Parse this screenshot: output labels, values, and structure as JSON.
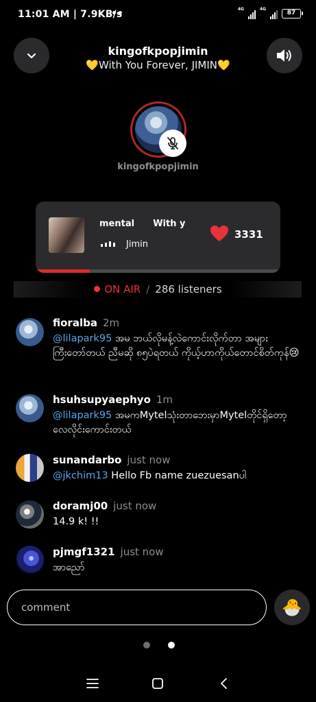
{
  "status_bar": {
    "time": "11:01 AM",
    "speed": "7.9KB/s",
    "dots": "••",
    "signal1_label": "4G",
    "signal2_label": "4G",
    "battery": "87"
  },
  "header": {
    "title": "kingofkpopjimin",
    "subtitle": "💛With You Forever, JIMIN💛"
  },
  "host": {
    "name": "kingofkpopjimin",
    "mic_muted": true
  },
  "now_playing": {
    "title_scroll": "mental      With y",
    "artist": "Jimin",
    "likes": "3331",
    "progress": 0.22
  },
  "live": {
    "status": "ON AIR",
    "separator": "/",
    "listeners": "286 listeners"
  },
  "comments": [
    {
      "user": "fioralba",
      "time": "2m",
      "mention": "@lilapark95",
      "text": " အမ ဘယ်လိုမန့်လဲကောင်းလိုက်တာ အများကြီးတော်တယ် ညီမဆို ၈၅ပဲရတယ် ကိုယ့်ဟာကိုယ်တောင်စိတ်ကုန်😢"
    },
    {
      "user": "hsuhsupyaephyo",
      "time": "1m",
      "mention": "@lilapark95",
      "text": " အမကMytelသုံးတာဘေးမှာMytelတိုင်ရှိတော့လေလိုင်းကောင်းတယ်"
    },
    {
      "user": "sunandarbo",
      "time": "just now",
      "mention": "@jkchim13",
      "text": " Hello Fb name zuezuesanပါ"
    },
    {
      "user": "doramj00",
      "time": "just now",
      "mention": "",
      "text": "14.9 k! !!"
    },
    {
      "user": "pjmgf1321",
      "time": "just now",
      "mention": "",
      "text": "အာညော်"
    }
  ],
  "input": {
    "placeholder": "comment",
    "emoji": "🐣"
  },
  "colors": {
    "accent_red": "#e8333b",
    "mention_blue": "#58a6e6",
    "card_bg": "#2b2b2e"
  }
}
